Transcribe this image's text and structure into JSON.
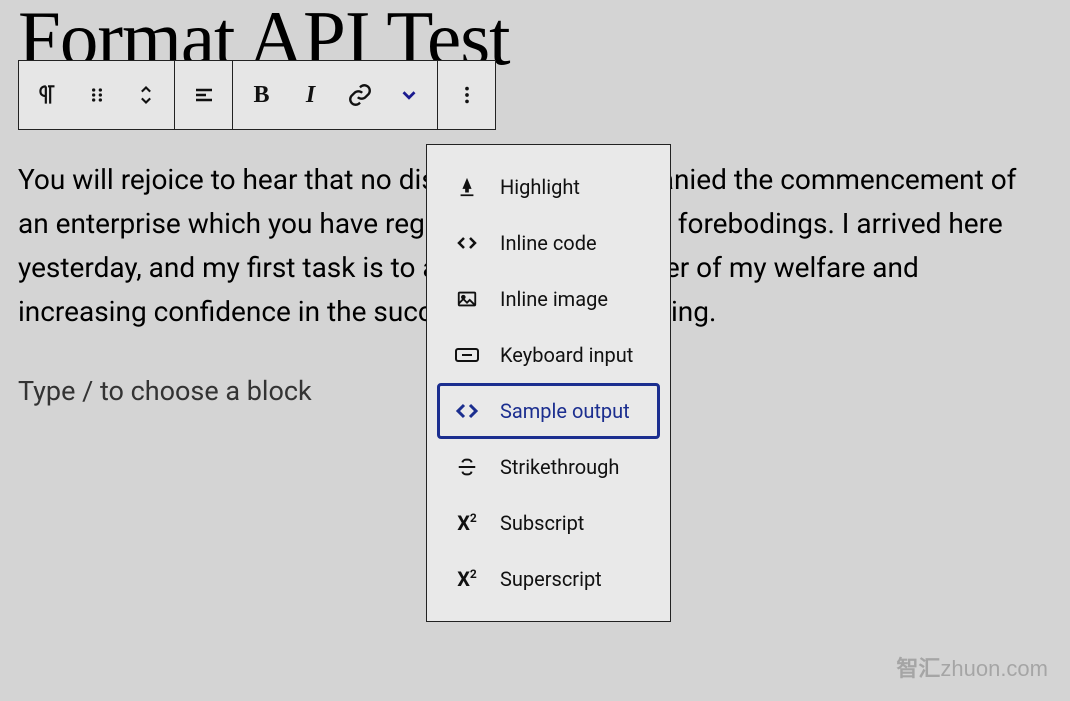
{
  "page": {
    "title": "Format API Test",
    "paragraph": "You will rejoice to hear that no disaster has accompanied the commencement of an enterprise which you have regarded with such evil forebodings. I arrived here yesterday, and my first task is to assure my dear sister of my welfare and increasing confidence in the success of my undertaking.",
    "placeholder": "Type / to choose a block"
  },
  "toolbar": {
    "block_type": "paragraph",
    "drag": "drag-handle",
    "move": "move-up-down",
    "align": "align-left",
    "bold": "B",
    "italic": "I",
    "link": "link",
    "more_formats": "chevron-down",
    "options": "more-vertical"
  },
  "dropdown": {
    "items": [
      {
        "icon": "highlight",
        "label": "Highlight",
        "selected": false
      },
      {
        "icon": "inline-code",
        "label": "Inline code",
        "selected": false
      },
      {
        "icon": "inline-image",
        "label": "Inline image",
        "selected": false
      },
      {
        "icon": "keyboard-input",
        "label": "Keyboard input",
        "selected": false
      },
      {
        "icon": "sample-output",
        "label": "Sample output",
        "selected": true
      },
      {
        "icon": "strikethrough",
        "label": "Strikethrough",
        "selected": false
      },
      {
        "icon": "subscript",
        "label": "Subscript",
        "selected": false
      },
      {
        "icon": "superscript",
        "label": "Superscript",
        "selected": false
      }
    ]
  },
  "watermark": {
    "zh": "智汇",
    "en": "zhuon.com"
  },
  "colors": {
    "accent": "#1b2e8f",
    "panel": "#e9e9e9",
    "bg": "#d4d4d4"
  }
}
